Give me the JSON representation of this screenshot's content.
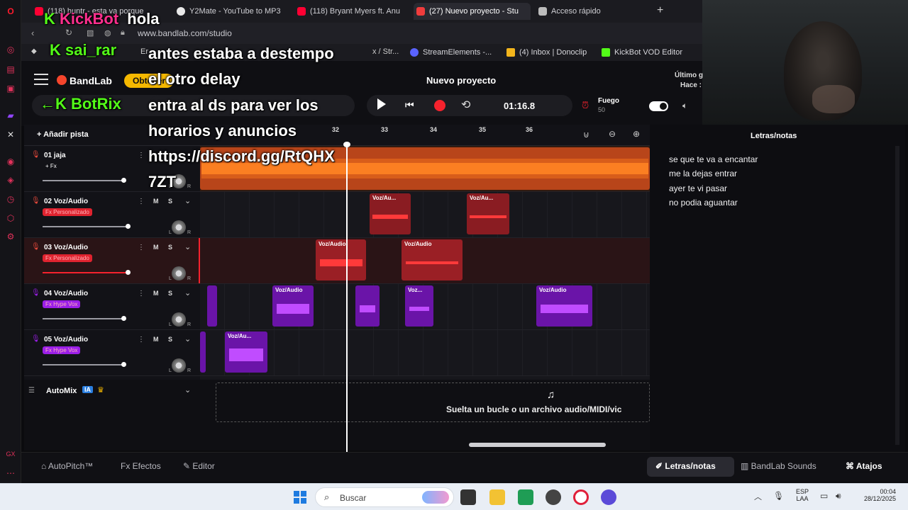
{
  "browser": {
    "tabs": [
      {
        "label": "(118) huntr - esta va porque",
        "color": "#ff0033"
      },
      {
        "label": "Y2Mate - YouTube to MP3",
        "color": "#e9e9e9"
      },
      {
        "label": "(118) Bryant Myers ft. Anu",
        "color": "#ff0033"
      },
      {
        "label": "(27) Nuevo proyecto - Stu",
        "color": "#f03c3c"
      },
      {
        "label": "Acceso rápido",
        "color": "#bbbbbb"
      }
    ],
    "url": "www.bandlab.com/studio",
    "bookmarks": [
      {
        "label": "StreamElements -...",
        "color": "#5a63ff"
      },
      {
        "label": "(4) Inbox | Donoclip",
        "color": "#f3b51c"
      },
      {
        "label": "KickBot VOD Editor",
        "color": "#53fc18"
      }
    ],
    "bookmarks_partial": "Er",
    "bookmarks_partial2": "x / Str..."
  },
  "header": {
    "brand": "BandLab",
    "promo": "Obtener",
    "project_title": "Nuevo proyecto",
    "time": "01:16.8",
    "fire_label": "Fuego",
    "fire_value": "50",
    "last_save_1": "Último g",
    "last_save_2": "Hace :"
  },
  "toolbar": {
    "add_track": "Añadir pista",
    "ruler": [
      "32",
      "33",
      "34",
      "35",
      "36"
    ]
  },
  "tracks": [
    {
      "num": "01",
      "name": "jaja",
      "fx": "+ Fx",
      "fx_color": "transparent",
      "mic": "#e84a3c",
      "vol": 0.76
    },
    {
      "num": "02",
      "name": "Voz/Audio",
      "fx": "Fx Personalizado",
      "fx_color": "#e0232f",
      "mic": "#e84a3c",
      "vol": 0.8
    },
    {
      "num": "03",
      "name": "Voz/Audio",
      "fx": "Fx Personalizado",
      "fx_color": "#e0232f",
      "mic": "#e84a3c",
      "vol": 0.8
    },
    {
      "num": "04",
      "name": "Voz/Audio",
      "fx": "Fx Hype Vox",
      "fx_color": "#9b1ee8",
      "mic": "#9b1ee8",
      "vol": 0.76
    },
    {
      "num": "05",
      "name": "Voz/Audio",
      "fx": "Fx Hype Vox",
      "fx_color": "#9b1ee8",
      "mic": "#9b1ee8",
      "vol": 0.76
    }
  ],
  "clip_label": "Voz/Audio",
  "clip_label_short": "Voz/Au...",
  "clip_label_tiny": "Voz...",
  "automix": {
    "label": "AutoMix",
    "badge": "IA"
  },
  "drop_zone": "Suelta un bucle o un archivo audio/MIDI/vic",
  "lyrics": {
    "title": "Letras/notas",
    "lines": [
      "se que te va a encantar",
      "me la dejas  entrar",
      "ayer te vi pasar",
      "no podia aguantar"
    ]
  },
  "bottom": {
    "autopitch": "AutoPitch™",
    "effects": "Efectos",
    "editor": "Editor",
    "lyrics": "Letras/notas",
    "sounds": "BandLab Sounds",
    "shortcuts": "Atajos"
  },
  "taskbar": {
    "search": "Buscar",
    "lang1": "ESP",
    "lang2": "LAA",
    "clock_time": "00:04",
    "clock_date": "28/12/2025"
  },
  "chat": {
    "user1": "KickBot",
    "msg1": "hola",
    "user2": "sai_rar",
    "msg2a": "antes estaba a destempo",
    "msg2b": "el otro delay",
    "user3": "BotRix",
    "msg3a": "entra al ds para ver los",
    "msg3b": "horarios y anuncios",
    "msg3c": "https://discord.gg/RtQHX",
    "msg3d": "7ZT"
  },
  "colors": {
    "accent": "#f5452c",
    "track1": "#f26a1b",
    "track23": "#e0232f",
    "track45": "#9b1ee8"
  }
}
